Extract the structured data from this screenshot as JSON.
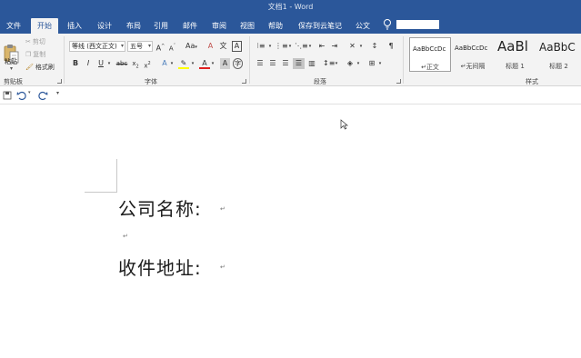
{
  "window": {
    "title": "文档1  -  Word"
  },
  "tabs": [
    {
      "label": "文件",
      "active": false
    },
    {
      "label": "开始",
      "active": true
    },
    {
      "label": "插入",
      "active": false
    },
    {
      "label": "设计",
      "active": false
    },
    {
      "label": "布局",
      "active": false
    },
    {
      "label": "引用",
      "active": false
    },
    {
      "label": "邮件",
      "active": false
    },
    {
      "label": "审阅",
      "active": false
    },
    {
      "label": "视图",
      "active": false
    },
    {
      "label": "帮助",
      "active": false
    },
    {
      "label": "保存到云笔记",
      "active": false
    },
    {
      "label": "公文",
      "active": false
    }
  ],
  "ribbon": {
    "clipboard": {
      "paste_label": "粘贴",
      "cut_label": "剪切",
      "copy_label": "复制",
      "format_painter_label": "格式刷",
      "group_label": "剪贴板"
    },
    "font": {
      "font_name": "等线 (西文正文)",
      "font_size": "五号",
      "group_label": "字体"
    },
    "paragraph": {
      "group_label": "段落"
    },
    "styles": {
      "group_label": "样式",
      "items": [
        {
          "sample": "AaBbCcDc",
          "name": "正文"
        },
        {
          "sample": "AaBbCcDc",
          "name": "无间隔"
        },
        {
          "sample": "AaBl",
          "name": "标题 1"
        },
        {
          "sample": "AaBbC",
          "name": "标题 2"
        }
      ]
    }
  },
  "document": {
    "lines": [
      "公司名称:",
      "收件地址:"
    ]
  },
  "colors": {
    "accent": "#2b579a",
    "ribbon_bg": "#f3f3f3"
  }
}
